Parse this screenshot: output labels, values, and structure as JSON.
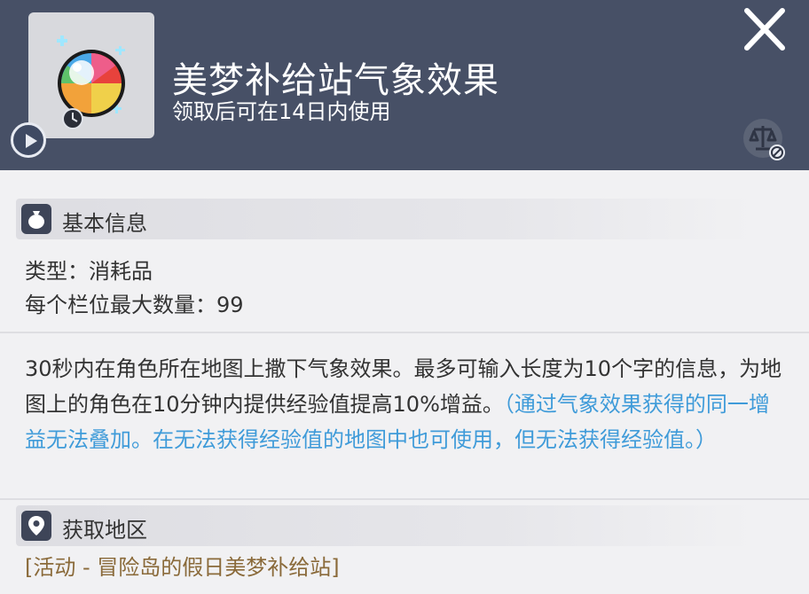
{
  "header": {
    "title": "美梦补给站气象效果",
    "subtitle": "领取后可在14日内使用",
    "item_icon": "beach-ball-icon",
    "colors": {
      "background": "#475066",
      "text": "#ffffff"
    }
  },
  "basic_info": {
    "section_title": "基本信息",
    "icon": "bag-icon",
    "type_line": "类型：消耗品",
    "max_stack_line": "每个栏位最大数量：99"
  },
  "description": {
    "main": "30秒内在角色所在地图上撒下气象效果。最多可输入长度为10个字的信息，为地图上的角色在10分钟内提供经验值提高10%增益。",
    "note": "（通过气象效果获得的同一增益无法叠加。在无法获得经验值的地图中也可使用，但无法获得经验值。）",
    "note_color": "#3f9bd9"
  },
  "acquire": {
    "section_title": "获取地区",
    "icon": "map-pin-icon",
    "region": "[活动 - 冒险岛的假日美梦补给站]",
    "region_color": "#8a6a3a"
  }
}
